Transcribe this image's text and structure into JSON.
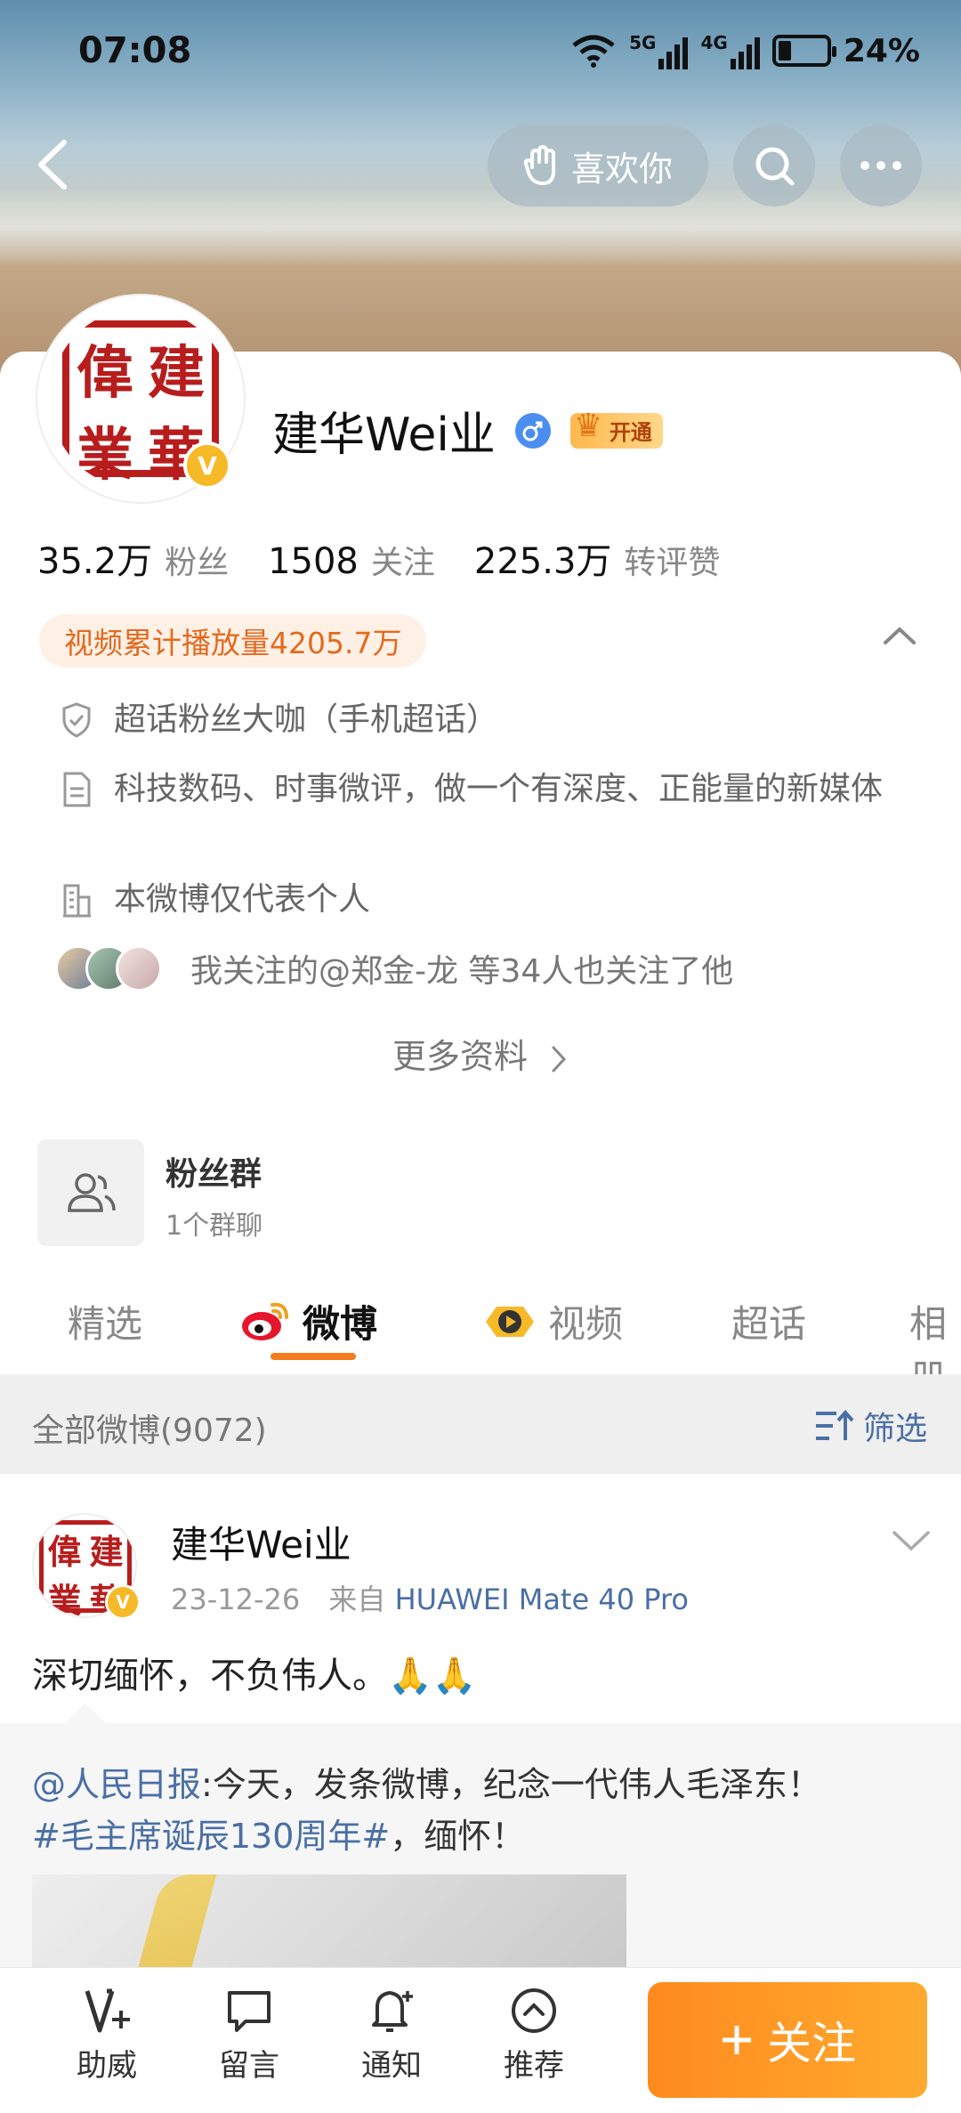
{
  "status": {
    "time": "07:08",
    "signal_5g": "5G",
    "signal_4g": "4G",
    "battery": "24%"
  },
  "header": {
    "like_label": "喜欢你"
  },
  "profile": {
    "name": "建华Wei业",
    "avatar_chars": [
      "偉",
      "建",
      "業",
      "華"
    ],
    "vip_label": "开通",
    "stats": [
      {
        "num": "35.2万",
        "label": "粉丝"
      },
      {
        "num": "1508",
        "label": "关注"
      },
      {
        "num": "225.3万",
        "label": "转评赞"
      }
    ],
    "play_count": "视频累计播放量4205.7万",
    "info": [
      {
        "icon": "shield-icon",
        "text": "超话粉丝大咖（手机超话）"
      },
      {
        "icon": "document-icon",
        "text": "科技数码、时事微评，做一个有深度、正能量的新媒体"
      },
      {
        "icon": "building-icon",
        "text": "本微博仅代表个人"
      }
    ],
    "mutual": "我关注的@郑金-龙 等34人也关注了他",
    "more_info": "更多资料",
    "fan_group": {
      "title": "粉丝群",
      "subtitle": "1个群聊"
    }
  },
  "tabs": [
    "精选",
    "微博",
    "视频",
    "超话",
    "相册"
  ],
  "filter": {
    "all_label": "全部微博(9072)",
    "filter_label": "筛选"
  },
  "post": {
    "author": "建华Wei业",
    "date": "23-12-26",
    "source_prefix": "来自",
    "device": "HUAWEI Mate 40 Pro",
    "text": "深切缅怀，不负伟人。🙏🙏",
    "repost_mention": "@人民日报",
    "repost_body": ":今天，发条微博，纪念一代伟人毛泽东！",
    "repost_tag": "#毛主席诞辰130周年#",
    "repost_tail": "，缅怀！"
  },
  "bottom_bar": {
    "items": [
      {
        "icon": "v-plus-icon",
        "label": "助威"
      },
      {
        "icon": "comment-icon",
        "label": "留言"
      },
      {
        "icon": "bell-plus-icon",
        "label": "通知"
      },
      {
        "icon": "chevron-up-circle-icon",
        "label": "推荐"
      }
    ],
    "follow_label": "关注"
  },
  "colors": {
    "accent_orange": "#f27b1e",
    "link_blue": "#4a6fa5",
    "vip_gold": "#f6b928"
  }
}
